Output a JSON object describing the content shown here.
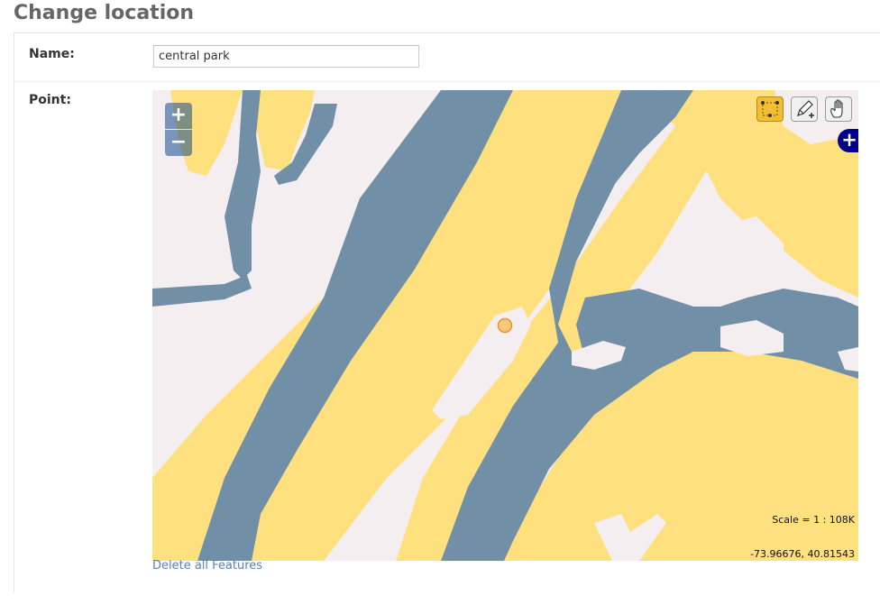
{
  "page": {
    "title": "Change location"
  },
  "form": {
    "name_label": "Name:",
    "name_value": "central park",
    "point_label": "Point:"
  },
  "map": {
    "zoom_in_label": "+",
    "zoom_out_label": "−",
    "tools": [
      {
        "name": "select-features",
        "icon": "select-points-icon",
        "active": true
      },
      {
        "name": "draw-point",
        "icon": "pencil-icon",
        "active": false
      },
      {
        "name": "pan-map",
        "icon": "hand-icon",
        "active": false
      }
    ],
    "layer_switcher_label": "+",
    "scale_text": "Scale = 1 : 108K",
    "mouse_position_text": "-73.96676, 40.81543",
    "colors": {
      "land": "#ffe07f",
      "water": "#728fa8",
      "urban": "#f4eef0",
      "feature_fill": "#f7c36e",
      "feature_stroke": "#e8942a",
      "active_tool": "#f2be33"
    }
  },
  "links": {
    "delete_all": "Delete all Features"
  }
}
